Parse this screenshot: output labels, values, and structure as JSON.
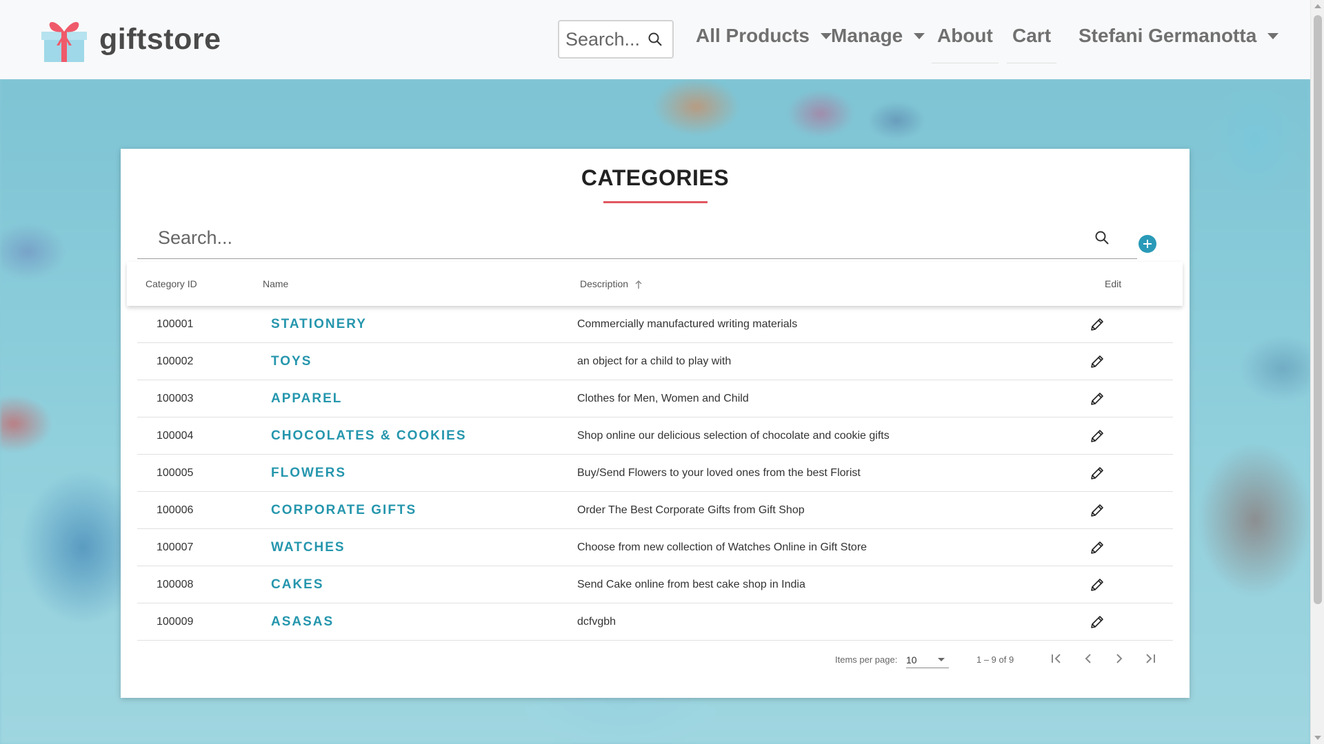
{
  "brand": {
    "name": "giftstore"
  },
  "nav": {
    "search_placeholder": "Search...",
    "all_products": "All Products",
    "manage": "Manage",
    "about": "About",
    "cart": "Cart",
    "user": "Stefani Germanotta"
  },
  "page": {
    "title": "CATEGORIES",
    "search_placeholder": "Search..."
  },
  "table": {
    "headers": {
      "id": "Category ID",
      "name": "Name",
      "description": "Description",
      "edit": "Edit"
    },
    "sort": {
      "column": "Description",
      "direction": "ascending"
    },
    "rows": [
      {
        "id": "100001",
        "name": "STATIONERY",
        "description": "Commercially manufactured writing materials"
      },
      {
        "id": "100002",
        "name": "TOYS",
        "description": "an object for a child to play with"
      },
      {
        "id": "100003",
        "name": "APPAREL",
        "description": "Clothes for Men, Women and Child"
      },
      {
        "id": "100004",
        "name": "CHOCOLATES & COOKIES",
        "description": "Shop online our delicious selection of chocolate and cookie gifts"
      },
      {
        "id": "100005",
        "name": "FLOWERS",
        "description": "Buy/Send Flowers to your loved ones from the best Florist"
      },
      {
        "id": "100006",
        "name": "CORPORATE GIFTS",
        "description": "Order The Best Corporate Gifts from Gift Shop"
      },
      {
        "id": "100007",
        "name": "WATCHES",
        "description": "Choose from new collection of Watches Online in Gift Store"
      },
      {
        "id": "100008",
        "name": "CAKES",
        "description": "Send Cake online from best cake shop in India"
      },
      {
        "id": "100009",
        "name": "ASASAS",
        "description": "dcfvgbh"
      }
    ]
  },
  "paginator": {
    "items_per_page_label": "Items per page:",
    "items_per_page": "10",
    "range": "1 – 9 of 9"
  },
  "colors": {
    "accent": "#2596ad",
    "title_rule": "#e05660",
    "add_button": "#2a9ab8"
  },
  "icons": {
    "nav_search": "search-icon",
    "table_search": "search-icon",
    "add": "plus-circle-icon",
    "edit": "pencil-icon",
    "first": "first-page-icon",
    "prev": "chevron-left-icon",
    "next": "chevron-right-icon",
    "last": "last-page-icon"
  }
}
